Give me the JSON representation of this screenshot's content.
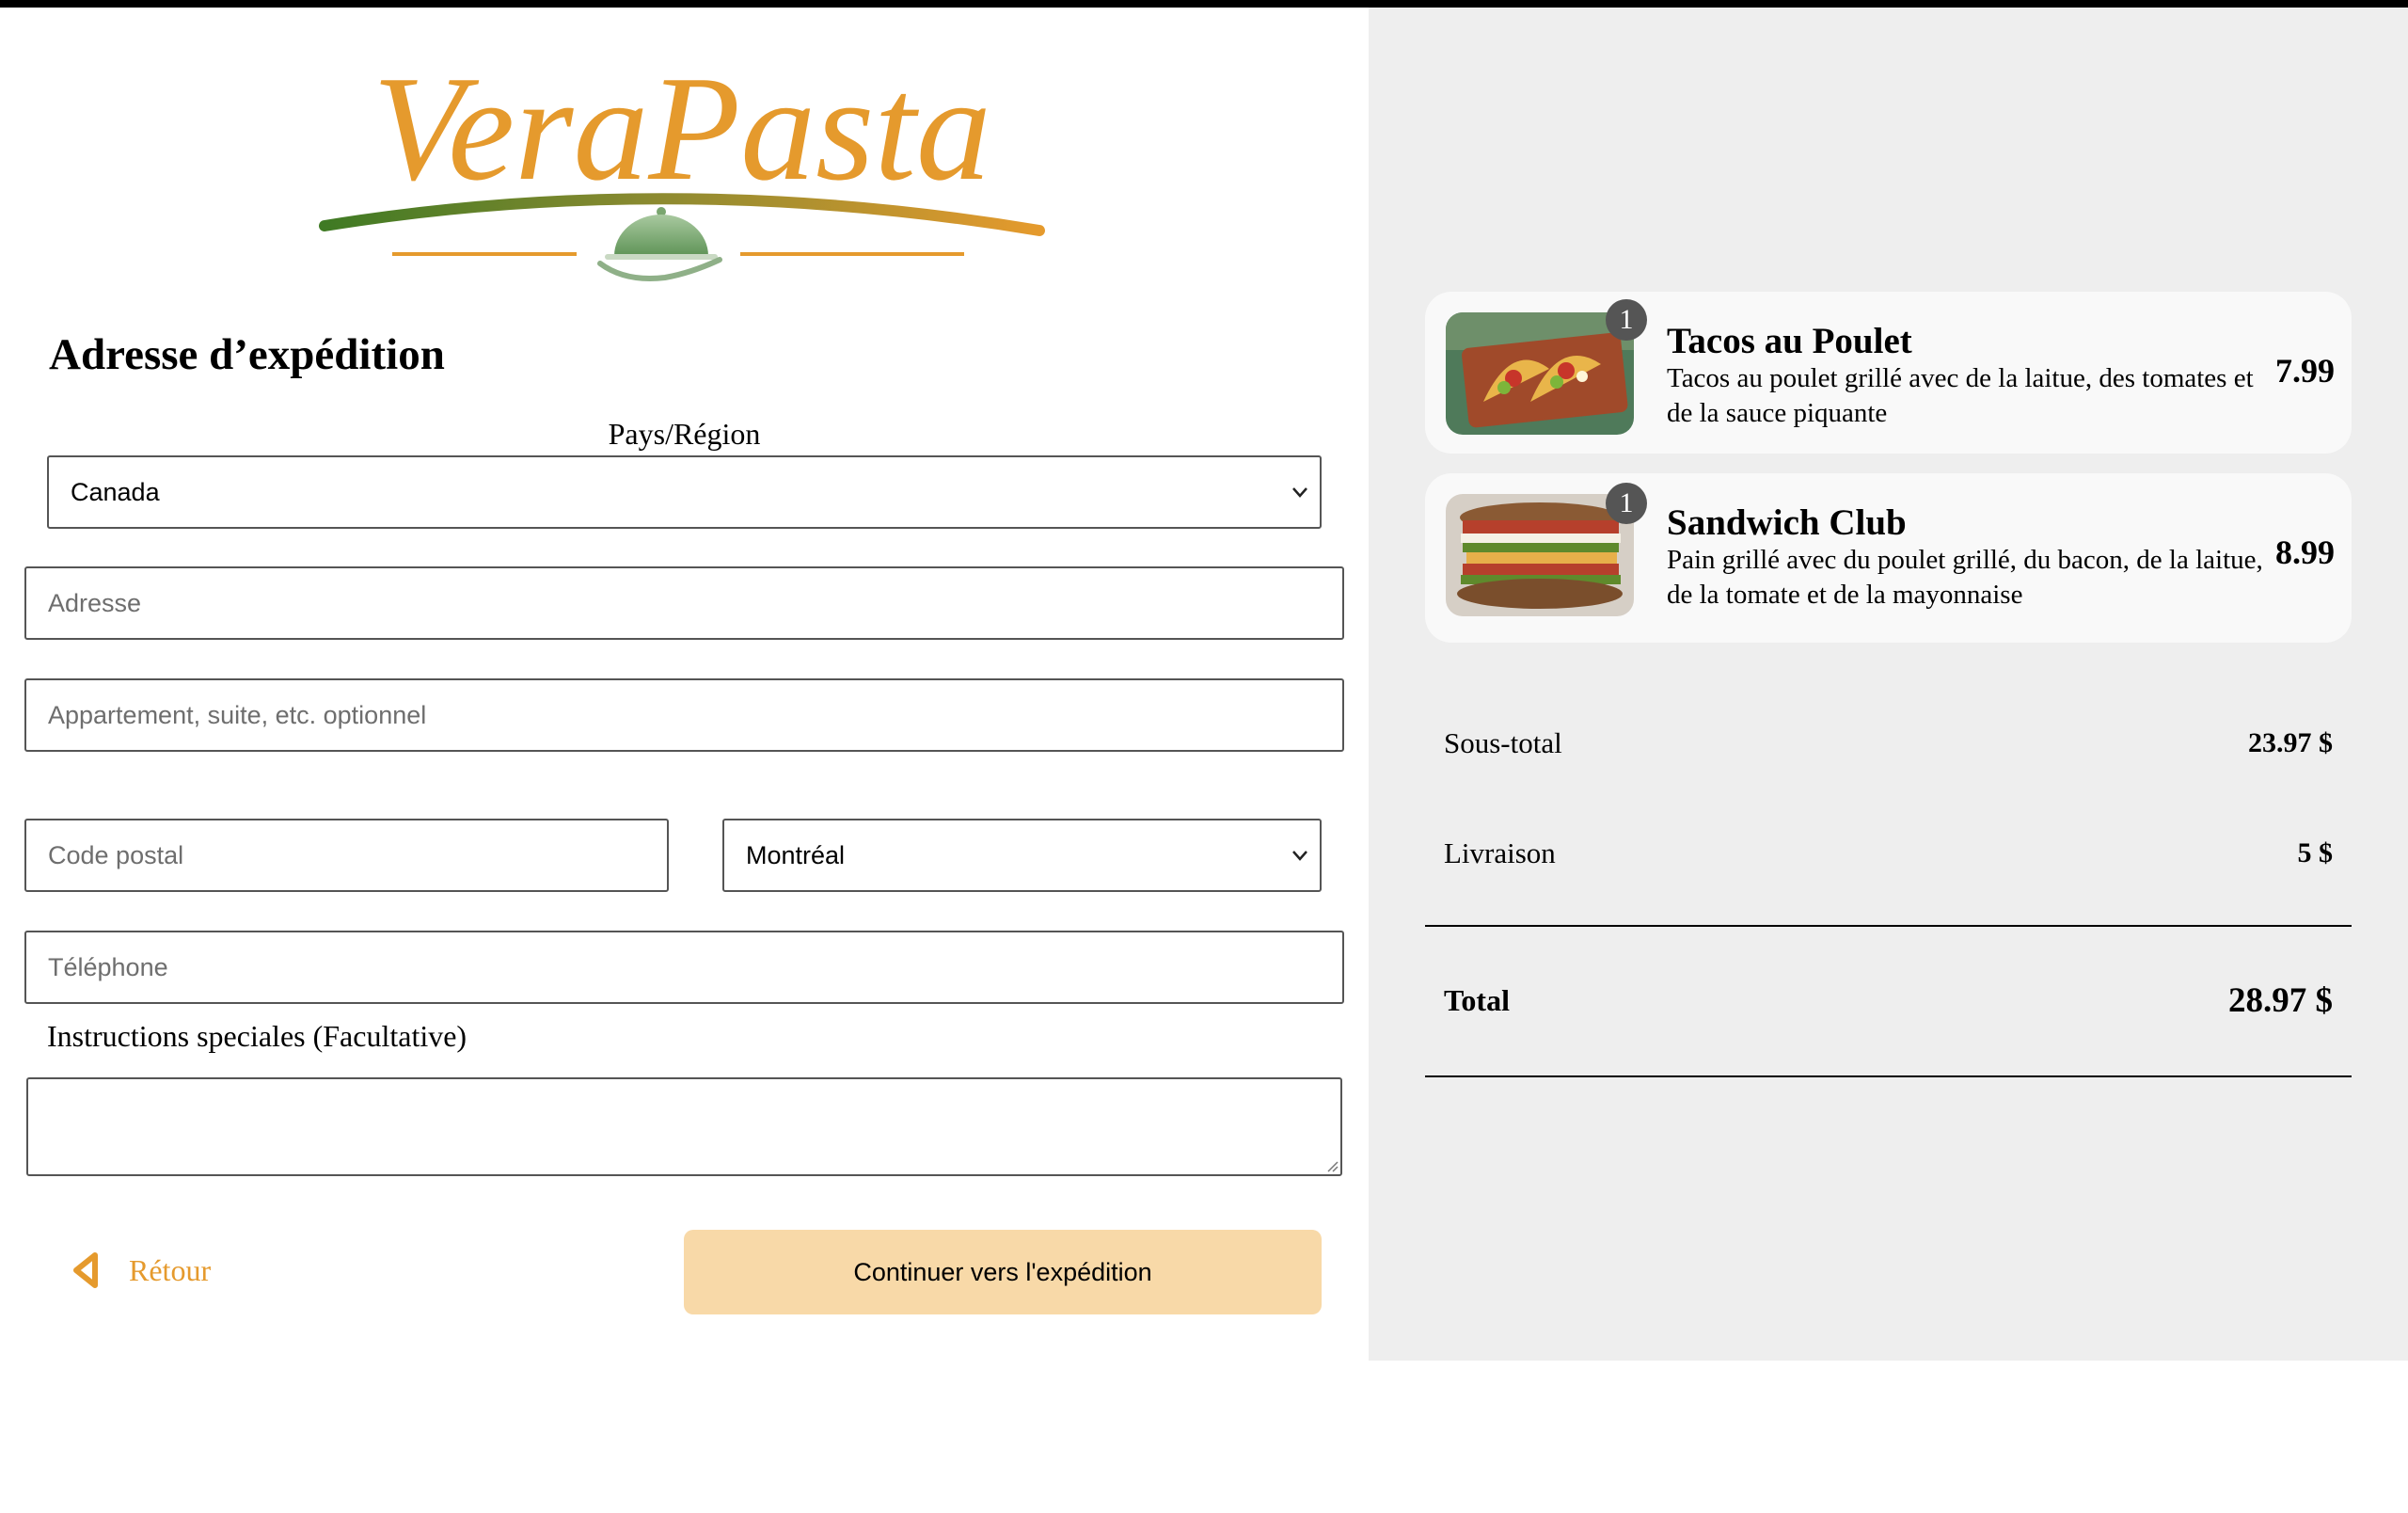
{
  "brand": {
    "name": "VeraPasta"
  },
  "form": {
    "title": "Adresse d’expédition",
    "country_label": "Pays/Région",
    "country_value": "Canada",
    "address_placeholder": "Adresse",
    "apartment_placeholder": "Appartement, suite, etc. optionnel",
    "postal_placeholder": "Code postal",
    "city_value": "Montréal",
    "phone_placeholder": "Téléphone",
    "instructions_label": "Instructions speciales (Facultative)",
    "back_label": "Rétour",
    "continue_label": "Continuer vers l'expédition"
  },
  "cart": {
    "items": [
      {
        "quantity": "1",
        "name": "Tacos au Poulet",
        "description": "Tacos au poulet grillé avec de la laitue, des tomates et de la sauce piquante",
        "price": "7.99",
        "icon": "tacos-image"
      },
      {
        "quantity": "1",
        "name": "Sandwich Club",
        "description": "Pain grillé avec du poulet grillé, du bacon, de la laitue, de la tomate et de la mayonnaise",
        "price": "8.99",
        "icon": "sandwich-image"
      }
    ],
    "subtotal_label": "Sous-total",
    "subtotal_value": "23.97 $",
    "delivery_label": "Livraison",
    "delivery_value": "5 $",
    "total_label": "Total",
    "total_value": "28.97 $"
  },
  "colors": {
    "brand_orange": "#e59a2d",
    "brand_green": "#4a7a2a",
    "button_bg": "#f8d9a8",
    "summary_bg": "#eeeeee"
  }
}
